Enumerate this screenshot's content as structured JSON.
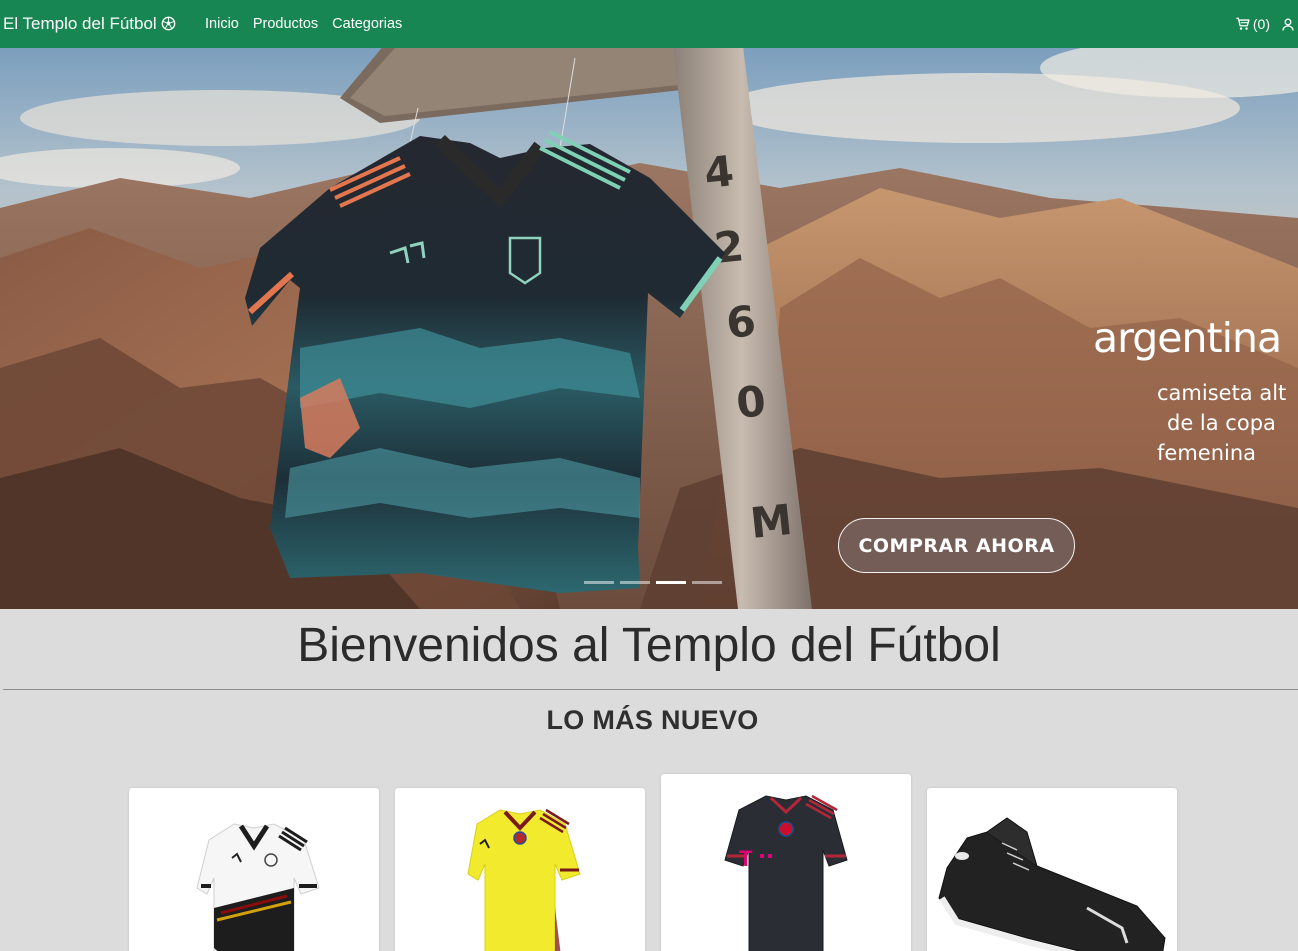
{
  "navbar": {
    "brand": "El Templo del Fútbol",
    "brand_icon": "soccer-ball-icon",
    "links": [
      "Inicio",
      "Productos",
      "Categorias"
    ],
    "cart_count": "(0)",
    "cart_icon": "cart-icon",
    "user_icon": "user-icon",
    "background": "#188652"
  },
  "hero": {
    "brand_word": "argentina",
    "subtitle": [
      "camiseta alt",
      "de la copa",
      "femenina"
    ],
    "post_text": [
      "4",
      "2",
      "6",
      "0",
      "M"
    ],
    "cta_label": "COMPRAR AHORA",
    "slides": 4,
    "active_slide": 3
  },
  "main": {
    "welcome_title": "Bienvenidos al Templo del Fútbol",
    "section_title": "LO MÁS NUEVO",
    "products": [
      {
        "name": "germany-jersey"
      },
      {
        "name": "colombia-jersey"
      },
      {
        "name": "bayern-jersey"
      },
      {
        "name": "puma-boots"
      }
    ]
  }
}
